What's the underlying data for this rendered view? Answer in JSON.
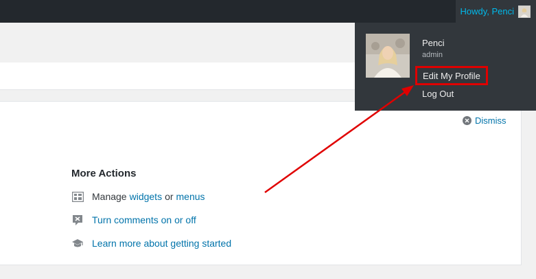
{
  "adminbar": {
    "howdy_text": "Howdy, Penci"
  },
  "user_menu": {
    "name": "Penci",
    "role": "admin",
    "edit_profile": "Edit My Profile",
    "logout": "Log Out"
  },
  "welcome": {
    "dismiss": "Dismiss",
    "more_actions_title": "More Actions",
    "actions": [
      {
        "icon": "widgets-icon",
        "prefix": "Manage",
        "link1": "widgets",
        "middle": "or",
        "link2": "menus"
      },
      {
        "icon": "comments-off-icon",
        "link": "Turn comments on or off"
      },
      {
        "icon": "learn-more-icon",
        "link": "Learn more about getting started"
      }
    ]
  },
  "colors": {
    "adminbar_bg": "#23282d",
    "dropdown_bg": "#32373c",
    "link": "#0073aa",
    "highlight_box": "#e00000"
  }
}
